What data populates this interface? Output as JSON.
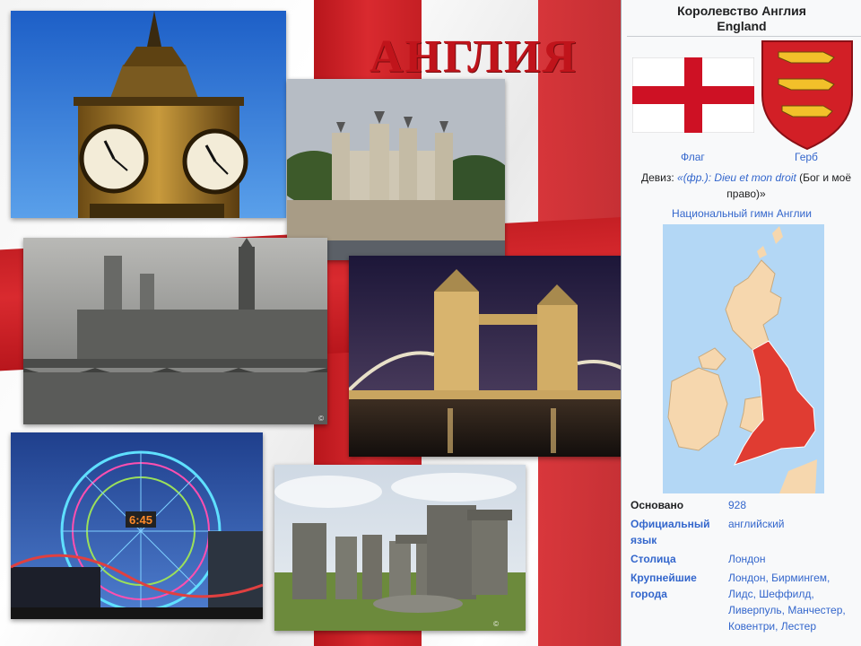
{
  "slide": {
    "title": "АНГЛИЯ",
    "colors": {
      "cross_red": "#c51f24",
      "title_red": "#c0141b"
    },
    "photos": [
      {
        "name": "big-ben"
      },
      {
        "name": "tower-of-london"
      },
      {
        "name": "westminster-fog"
      },
      {
        "name": "tower-bridge-night"
      },
      {
        "name": "ferris-wheel-night",
        "clock_text": "6:45"
      },
      {
        "name": "stonehenge"
      }
    ]
  },
  "infobox": {
    "title_ru": "Королевство Англия",
    "title_en": "England",
    "flag_caption": "Флаг",
    "coa_caption": "Герб",
    "motto_label": "Девиз:",
    "motto_lang": "«(фр.):",
    "motto_text": "Dieu et mon droit",
    "motto_translation": "(Бог и моё право)»",
    "anthem": "Национальный гимн Англии",
    "rows": [
      {
        "key": "Основано",
        "value": "928"
      },
      {
        "key": "Официальный язык",
        "value": "английский"
      },
      {
        "key": "Столица",
        "value": "Лондон"
      },
      {
        "key": "Крупнейшие города",
        "value": "Лондон, Бирмингем, Лидс, Шеффилд, Ливерпуль, Манчестер, Ковентри, Лестер"
      }
    ],
    "colors": {
      "link": "#3366cc",
      "england_map": "#e03c32",
      "other_map": "#f6d7ae",
      "sea": "#b3d7f5"
    }
  }
}
